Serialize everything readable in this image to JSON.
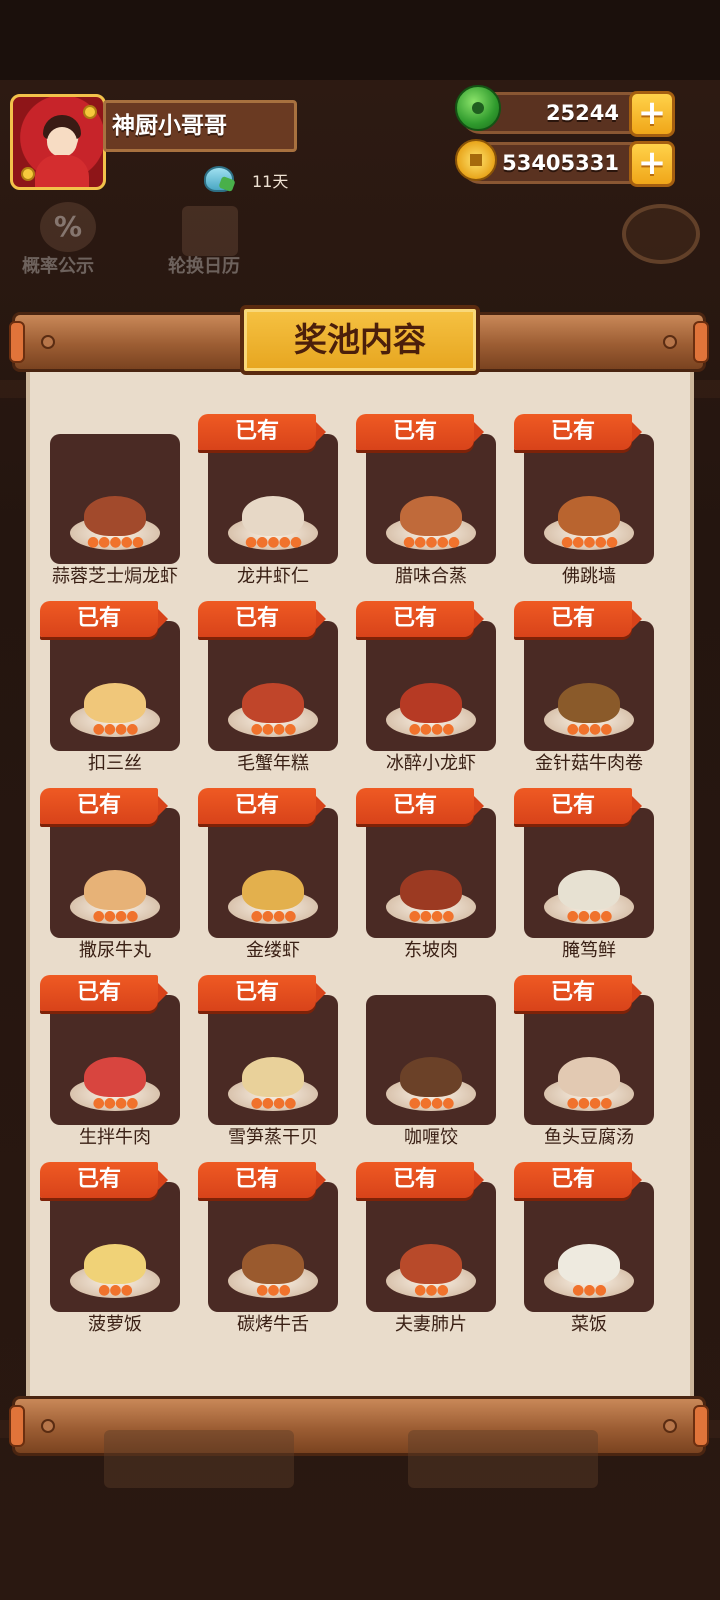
{
  "header": {
    "player_name": "神厨小哥哥",
    "days": "11天",
    "jade": "25244",
    "coins": "53405331",
    "plus": "+"
  },
  "menu": {
    "probability": "概率公示",
    "rotation": "轮换日历",
    "probability_icon": "%"
  },
  "panel": {
    "title": "奖池内容",
    "owned_label": "已有"
  },
  "dishes": [
    {
      "name": "蒜蓉芝士焗龙虾",
      "owned": false,
      "flames": 5
    },
    {
      "name": "龙井虾仁",
      "owned": true,
      "flames": 5
    },
    {
      "name": "腊味合蒸",
      "owned": true,
      "flames": 5
    },
    {
      "name": "佛跳墙",
      "owned": true,
      "flames": 5
    },
    {
      "name": "扣三丝",
      "owned": true,
      "flames": 4
    },
    {
      "name": "毛蟹年糕",
      "owned": true,
      "flames": 4
    },
    {
      "name": "冰醉小龙虾",
      "owned": true,
      "flames": 4
    },
    {
      "name": "金针菇牛肉卷",
      "owned": true,
      "flames": 4
    },
    {
      "name": "撒尿牛丸",
      "owned": true,
      "flames": 4
    },
    {
      "name": "金缕虾",
      "owned": true,
      "flames": 4
    },
    {
      "name": "东坡肉",
      "owned": true,
      "flames": 4
    },
    {
      "name": "腌笃鲜",
      "owned": true,
      "flames": 4
    },
    {
      "name": "生拌牛肉",
      "owned": true,
      "flames": 4
    },
    {
      "name": "雪笋蒸干贝",
      "owned": true,
      "flames": 4
    },
    {
      "name": "咖喱饺",
      "owned": false,
      "flames": 4
    },
    {
      "name": "鱼头豆腐汤",
      "owned": true,
      "flames": 4
    },
    {
      "name": "菠萝饭",
      "owned": true,
      "flames": 3
    },
    {
      "name": "碳烤牛舌",
      "owned": true,
      "flames": 3
    },
    {
      "name": "夫妻肺片",
      "owned": true,
      "flames": 3
    },
    {
      "name": "菜饭",
      "owned": true,
      "flames": 3
    }
  ],
  "colors": {
    "badge": "#e64f20",
    "card": "#4a2a24",
    "paper": "#e9dccb",
    "title_plate": "#f0b636"
  }
}
